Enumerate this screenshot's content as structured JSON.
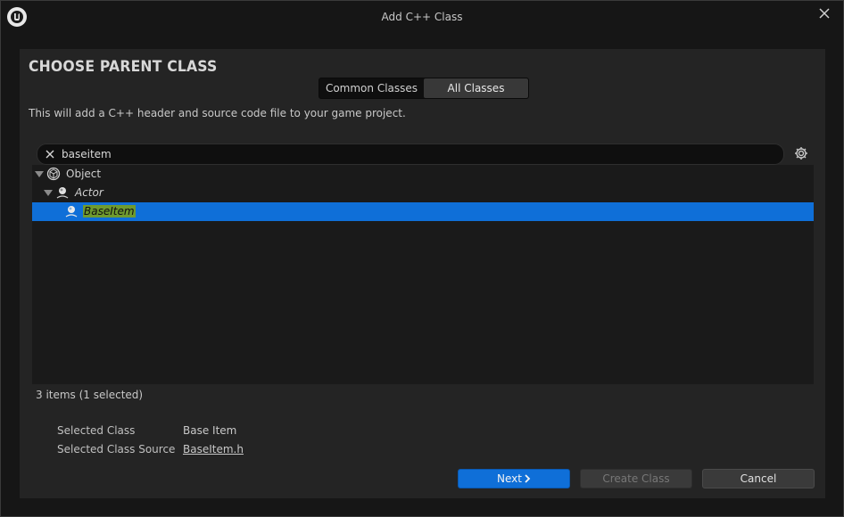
{
  "window": {
    "title": "Add C++ Class"
  },
  "dialog": {
    "heading": "CHOOSE PARENT CLASS",
    "tabs": [
      {
        "label": "Common Classes",
        "active": false
      },
      {
        "label": "All Classes",
        "active": true
      }
    ],
    "description": "This will add a C++ header and source code file to your game project."
  },
  "search": {
    "value": "baseitem"
  },
  "tree": {
    "items": [
      {
        "label": "Object",
        "depth": 0,
        "expanded": true,
        "italic": false,
        "selected": false,
        "icon": "object-icon"
      },
      {
        "label": "Actor",
        "depth": 1,
        "expanded": true,
        "italic": true,
        "selected": false,
        "icon": "actor-icon"
      },
      {
        "label": "BaseItem",
        "depth": 2,
        "expanded": false,
        "italic": true,
        "selected": true,
        "icon": "actor-icon"
      }
    ]
  },
  "status": {
    "count_text": "3 items (1 selected)"
  },
  "info": {
    "selected_class_label": "Selected Class",
    "selected_class_value": "Base Item",
    "selected_source_label": "Selected Class Source",
    "selected_source_value": "BaseItem.h"
  },
  "buttons": {
    "next": "Next",
    "create": "Create Class",
    "cancel": "Cancel"
  },
  "colors": {
    "accent": "#0f6fd8",
    "highlight": "#6f9a2e",
    "panel": "#242424",
    "background": "#161616"
  }
}
